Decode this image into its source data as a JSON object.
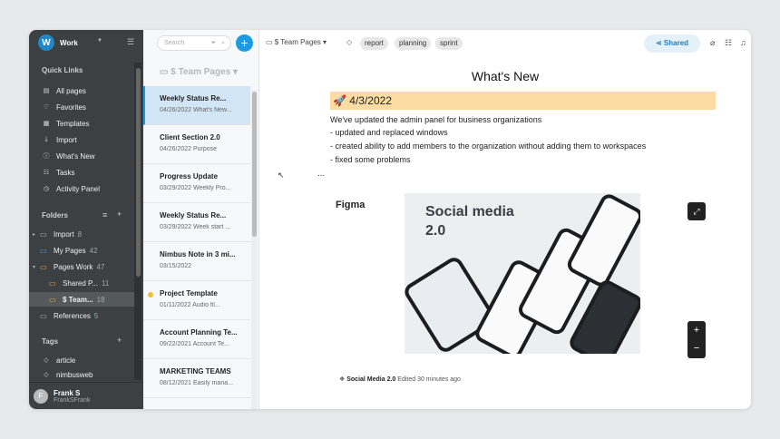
{
  "workspace": {
    "logo_letter": "W",
    "name": "Work"
  },
  "sidebar": {
    "quick_links_title": "Quick Links",
    "quick_links": [
      {
        "label": "All pages",
        "icon": "pages-icon"
      },
      {
        "label": "Favorites",
        "icon": "heart-icon"
      },
      {
        "label": "Templates",
        "icon": "template-icon"
      },
      {
        "label": "Import",
        "icon": "import-icon"
      },
      {
        "label": "What's New",
        "icon": "info-icon"
      },
      {
        "label": "Tasks",
        "icon": "tasks-icon"
      },
      {
        "label": "Activity Panel",
        "icon": "clock-icon"
      }
    ],
    "folders_title": "Folders",
    "folders": [
      {
        "label": "Import",
        "count": "8"
      },
      {
        "label": "My Pages",
        "count": "42"
      },
      {
        "label": "Pages Work",
        "count": "47"
      },
      {
        "label": "Shared P...",
        "count": "11"
      },
      {
        "label": "$ Team...",
        "count": "18"
      },
      {
        "label": "References",
        "count": "5"
      }
    ],
    "tags_title": "Tags",
    "tags": [
      "article",
      "nimbusweb"
    ],
    "user": {
      "initial": "F",
      "name": "Frank S",
      "login": "FrankSFrank"
    }
  },
  "note_list": {
    "search_placeholder": "Search",
    "header": "$ Team Pages",
    "notes": [
      {
        "title": "Weekly Status Re...",
        "subtitle": "04/26/2022 What's New..."
      },
      {
        "title": "Client Section 2.0",
        "subtitle": "04/26/2022 Purpose"
      },
      {
        "title": "Progress Update",
        "subtitle": "03/29/2022 Weekly Pro..."
      },
      {
        "title": "Weekly Status Re...",
        "subtitle": "03/29/2022 Week start ..."
      },
      {
        "title": "Nimbus Note in 3 mi...",
        "subtitle": "03/15/2022"
      },
      {
        "title": "Project Template",
        "subtitle": "01/11/2022 Audio fil..."
      },
      {
        "title": "Account Planning Te...",
        "subtitle": "09/22/2021 Account Te..."
      },
      {
        "title": "MARKETING TEAMS",
        "subtitle": "08/12/2021 Easily mana..."
      }
    ]
  },
  "main": {
    "breadcrumb": "$ Team Pages",
    "tags": [
      "report",
      "planning",
      "sprint"
    ],
    "share_label": "Shared",
    "title": "What's New",
    "date_heading": "🚀 4/3/2022",
    "body_lines": [
      "We've updated the admin panel for business organizations",
      "- updated and replaced windows",
      "- created ability to add members to the organization without adding them to workspaces",
      "- fixed some problems"
    ],
    "ellipsis": "...",
    "embed": {
      "provider": "Figma",
      "preview_title": "Social media",
      "preview_subtitle": "2.0",
      "file_name": "Social Media 2.0",
      "edited": "Edited 30 minutes ago"
    }
  }
}
